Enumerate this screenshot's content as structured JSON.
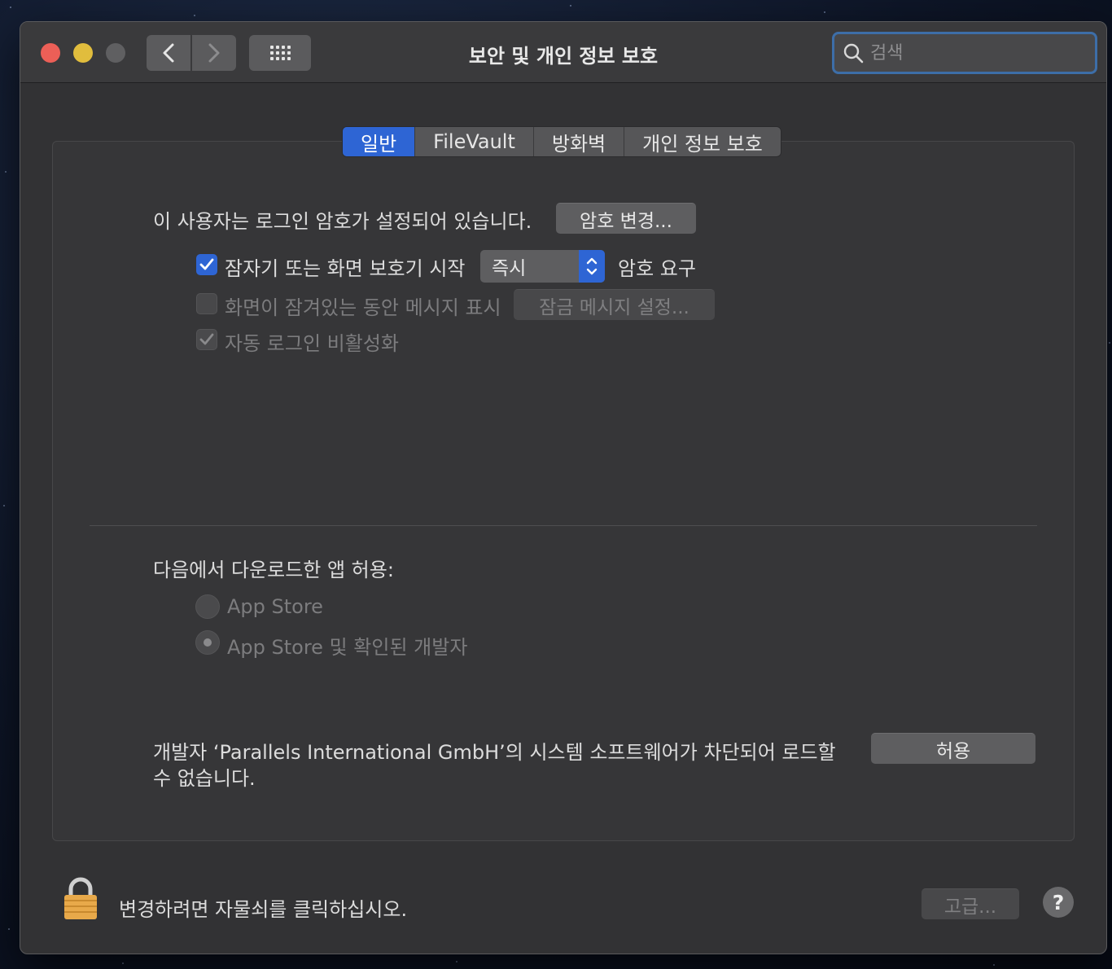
{
  "window": {
    "title": "보안 및 개인 정보 보호",
    "search_placeholder": "검색"
  },
  "tabs": [
    {
      "label": "일반",
      "active": true
    },
    {
      "label": "FileVault",
      "active": false
    },
    {
      "label": "방화벽",
      "active": false
    },
    {
      "label": "개인 정보 보호",
      "active": false
    }
  ],
  "general": {
    "password_status": "이 사용자는 로그인 암호가 설정되어 있습니다.",
    "change_password_button": "암호 변경...",
    "require_password_checkbox": {
      "label": "잠자기 또는 화면 보호기 시작",
      "checked": true
    },
    "require_password_select": "즉시",
    "require_password_suffix": "암호 요구",
    "show_message_checkbox": {
      "label": "화면이 잠겨있는 동안 메시지 표시",
      "checked": false,
      "enabled": false
    },
    "set_lock_message_button": "잠금 메시지 설정...",
    "disable_autologin_checkbox": {
      "label": "자동 로그인 비활성화",
      "checked": true,
      "enabled": false
    }
  },
  "downloads": {
    "heading": "다음에서 다운로드한 앱 허용:",
    "options": [
      {
        "label": "App Store",
        "selected": false
      },
      {
        "label": "App Store 및 확인된 개발자",
        "selected": true
      }
    ]
  },
  "blocked": {
    "message_line1": "개발자 ‘Parallels International GmbH’의 시스템 소프트웨어가 차단되어 로드할",
    "message_line2": "수 없습니다.",
    "allow_button": "허용"
  },
  "footer": {
    "lock_text": "변경하려면 자물쇠를 클릭하십시오.",
    "advanced_button": "고급...",
    "help_button": "?"
  },
  "colors": {
    "accent": "#2e65d4",
    "close": "#ec5f57",
    "minimize": "#e1bd3d",
    "window_bg": "#323234"
  }
}
